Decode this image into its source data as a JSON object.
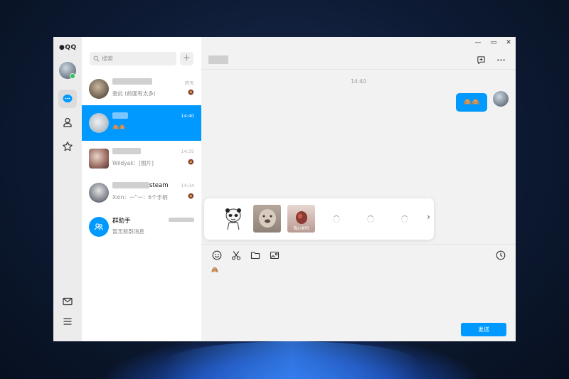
{
  "app": {
    "logo_text": "QQ"
  },
  "search": {
    "placeholder": "搜索"
  },
  "list": {
    "add_label": "+",
    "conversations": [
      {
        "time": "昨天",
        "preview": "妾此 (前面有太多)"
      },
      {
        "time": "14:40",
        "preview": "🙈🙈"
      },
      {
        "time": "14:35",
        "preview": "Wildyak：[图片]"
      },
      {
        "name_suffix": "steam",
        "time": "14:34",
        "preview": "Xxin：一“一：6个手柄"
      },
      {
        "name": "群助手",
        "preview": "暂无新群消息"
      }
    ]
  },
  "chat": {
    "timestamp": "14:40",
    "bubble_text": "🙈🙈",
    "stickers": [
      {
        "label": ""
      },
      {
        "label": ""
      },
      {
        "label": "我心老吗"
      }
    ],
    "draft_text": "🙈",
    "send_label": "发送"
  },
  "colors": {
    "accent": "#0099ff",
    "online": "#2bc55a"
  }
}
